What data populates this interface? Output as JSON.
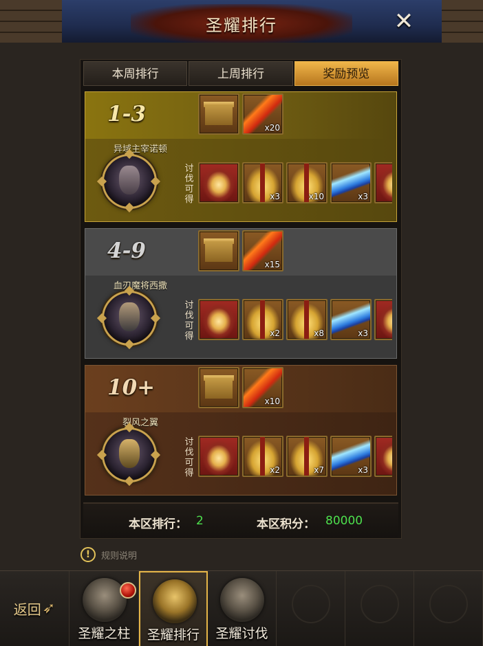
{
  "header": {
    "title": "圣耀排行",
    "close_glyph": "✕"
  },
  "tabs": [
    {
      "label": "本周排行",
      "active": false
    },
    {
      "label": "上周排行",
      "active": false
    },
    {
      "label": "奖励预览",
      "active": true
    }
  ],
  "rank_blocks": [
    {
      "range": "1-3",
      "boss_name": "异域主宰诺顿",
      "side_text": [
        "讨",
        "伐",
        "可",
        "得"
      ],
      "top_rewards": [
        {
          "icon": "treasure-chest-icon",
          "qty": ""
        },
        {
          "icon": "feather-icon",
          "qty": "x20"
        }
      ],
      "kill_rewards": [
        {
          "icon": "lantern-icon",
          "qty": ""
        },
        {
          "icon": "gift-box-icon",
          "qty": "x3"
        },
        {
          "icon": "gift-box-icon",
          "qty": "x10"
        },
        {
          "icon": "crystal-icon",
          "qty": "x3"
        }
      ]
    },
    {
      "range": "4-9",
      "boss_name": "血刃魔将西撒",
      "side_text": [
        "讨",
        "伐",
        "可",
        "得"
      ],
      "top_rewards": [
        {
          "icon": "treasure-chest-icon",
          "qty": ""
        },
        {
          "icon": "feather-icon",
          "qty": "x15"
        }
      ],
      "kill_rewards": [
        {
          "icon": "lantern-icon",
          "qty": ""
        },
        {
          "icon": "gift-box-icon",
          "qty": "x2"
        },
        {
          "icon": "gift-box-icon",
          "qty": "x8"
        },
        {
          "icon": "crystal-icon",
          "qty": "x3"
        }
      ]
    },
    {
      "range": "10+",
      "boss_name": "裂风之翼",
      "side_text": [
        "讨",
        "伐",
        "可",
        "得"
      ],
      "top_rewards": [
        {
          "icon": "treasure-chest-icon",
          "qty": ""
        },
        {
          "icon": "feather-icon",
          "qty": "x10"
        }
      ],
      "kill_rewards": [
        {
          "icon": "lantern-icon",
          "qty": ""
        },
        {
          "icon": "gift-box-icon",
          "qty": "x2"
        },
        {
          "icon": "gift-box-icon",
          "qty": "x7"
        },
        {
          "icon": "crystal-icon",
          "qty": "x3"
        }
      ]
    }
  ],
  "score": {
    "rank_label": "本区排行：",
    "rank_value": "2",
    "points_label": "本区积分：",
    "points_value": "80000"
  },
  "rules": {
    "icon": "!",
    "label": "规则说明"
  },
  "bottom_nav": {
    "back_label": "返回",
    "back_arrow": "➶",
    "items": [
      {
        "label": "圣耀之柱",
        "icon": "pillar-emblem-icon",
        "active": false,
        "has_badge": true
      },
      {
        "label": "圣耀排行",
        "icon": "ranking-emblem-icon",
        "active": true,
        "has_badge": false
      },
      {
        "label": "圣耀讨伐",
        "icon": "crossed-swords-emblem-icon",
        "active": false,
        "has_badge": false
      }
    ]
  },
  "colors": {
    "accent_gold": "#e6b648",
    "score_green": "#4de04d",
    "block1": "#8a7410",
    "block2": "#4a4a4a",
    "block3": "#6b3f1e"
  }
}
